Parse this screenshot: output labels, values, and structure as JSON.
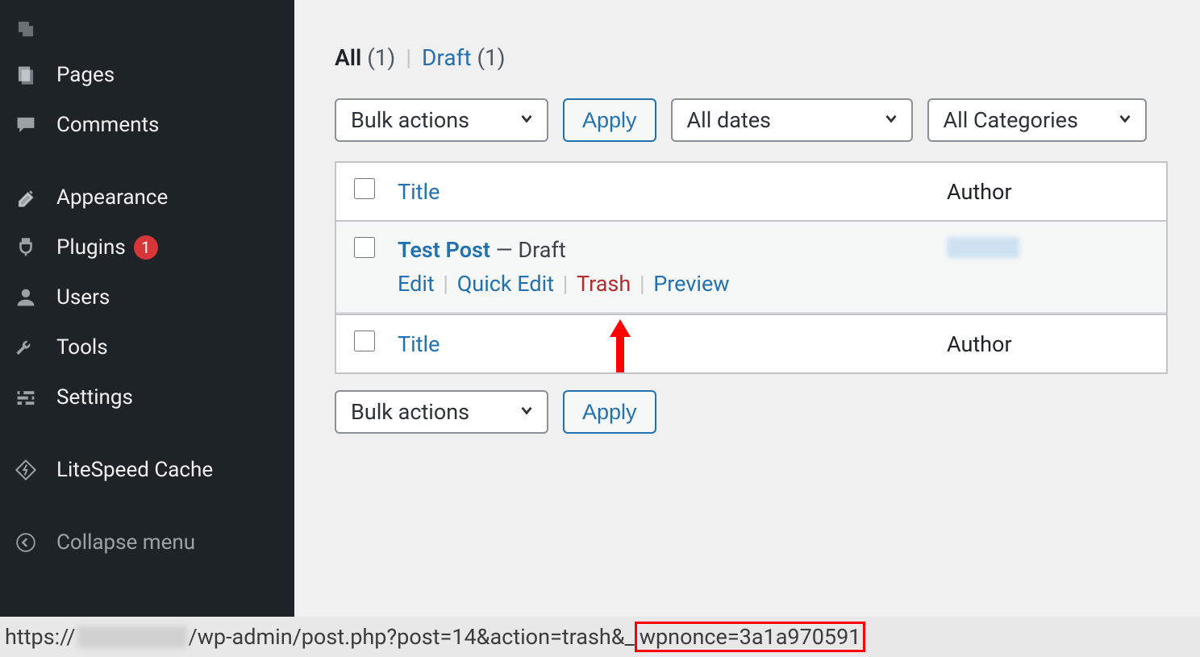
{
  "sidebar": {
    "items": [
      {
        "label": "Pages",
        "icon": "pages-icon"
      },
      {
        "label": "Comments",
        "icon": "comments-icon"
      },
      {
        "label": "Appearance",
        "icon": "appearance-icon"
      },
      {
        "label": "Plugins",
        "icon": "plugins-icon",
        "badge": "1"
      },
      {
        "label": "Users",
        "icon": "users-icon"
      },
      {
        "label": "Tools",
        "icon": "tools-icon"
      },
      {
        "label": "Settings",
        "icon": "settings-icon"
      },
      {
        "label": "LiteSpeed Cache",
        "icon": "litespeed-icon"
      },
      {
        "label": "Collapse menu",
        "icon": "collapse-icon"
      }
    ]
  },
  "filters": {
    "all_label": "All",
    "all_count": "(1)",
    "draft_label": "Draft",
    "draft_count": "(1)"
  },
  "toolbar": {
    "bulk_label": "Bulk actions",
    "apply_label": "Apply",
    "dates_label": "All dates",
    "categories_label": "All Categories"
  },
  "table": {
    "title_header": "Title",
    "author_header": "Author",
    "row": {
      "title": "Test Post",
      "status": " — Draft",
      "actions": {
        "edit": "Edit",
        "quick_edit": "Quick Edit",
        "trash": "Trash",
        "preview": "Preview"
      }
    }
  },
  "statusbar": {
    "prefix": "https://",
    "middle": "/wp-admin/post.php?post=14&action=trash&",
    "nonce_full": "_wpnonce=3a1a970591",
    "nonce_underscore": "_",
    "nonce_rest": "wpnonce=3a1a970591"
  }
}
